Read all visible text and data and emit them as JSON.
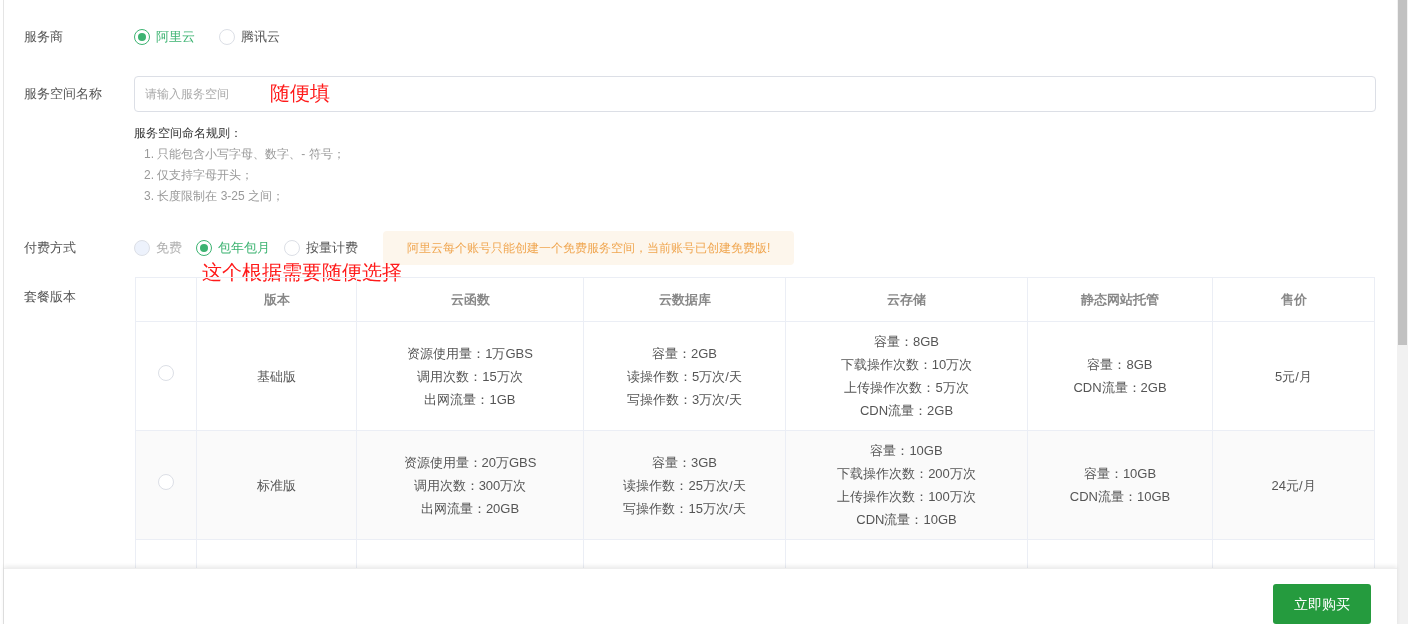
{
  "provider": {
    "label": "服务商",
    "options": [
      {
        "label": "阿里云",
        "selected": true
      },
      {
        "label": "腾讯云",
        "selected": false
      }
    ]
  },
  "space_name": {
    "label": "服务空间名称",
    "placeholder": "请输入服务空间",
    "annotation": "随便填"
  },
  "rules": {
    "title": "服务空间命名规则：",
    "items": [
      "1. 只能包含小写字母、数字、- 符号；",
      "2. 仅支持字母开头；",
      "3. 长度限制在 3-25 之间；"
    ]
  },
  "payment": {
    "label": "付费方式",
    "options": [
      {
        "label": "免费",
        "selected": false,
        "disabled": true
      },
      {
        "label": "包年包月",
        "selected": true,
        "disabled": false
      },
      {
        "label": "按量计费",
        "selected": false,
        "disabled": false
      }
    ],
    "notice": "阿里云每个账号只能创建一个免费服务空间，当前账号已创建免费版!",
    "annotation": "这个根据需要随便选择"
  },
  "plan": {
    "label": "套餐版本",
    "columns": [
      "版本",
      "云函数",
      "云数据库",
      "云存储",
      "静态网站托管",
      "售价"
    ],
    "rows": [
      {
        "selected": false,
        "cells": [
          [
            "基础版"
          ],
          [
            "资源使用量：1万GBS",
            "调用次数：15万次",
            "出网流量：1GB"
          ],
          [
            "容量：2GB",
            "读操作数：5万次/天",
            "写操作数：3万次/天"
          ],
          [
            "容量：8GB",
            "下载操作次数：10万次",
            "上传操作次数：5万次",
            "CDN流量：2GB"
          ],
          [
            "容量：8GB",
            "CDN流量：2GB"
          ],
          [
            "5元/月"
          ]
        ]
      },
      {
        "selected": false,
        "cells": [
          [
            "标准版"
          ],
          [
            "资源使用量：20万GBS",
            "调用次数：300万次",
            "出网流量：20GB"
          ],
          [
            "容量：3GB",
            "读操作数：25万次/天",
            "写操作数：15万次/天"
          ],
          [
            "容量：10GB",
            "下载操作次数：200万次",
            "上传操作次数：100万次",
            "CDN流量：10GB"
          ],
          [
            "容量：10GB",
            "CDN流量：10GB"
          ],
          [
            "24元/月"
          ]
        ]
      }
    ]
  },
  "buy_button": "立即购买"
}
